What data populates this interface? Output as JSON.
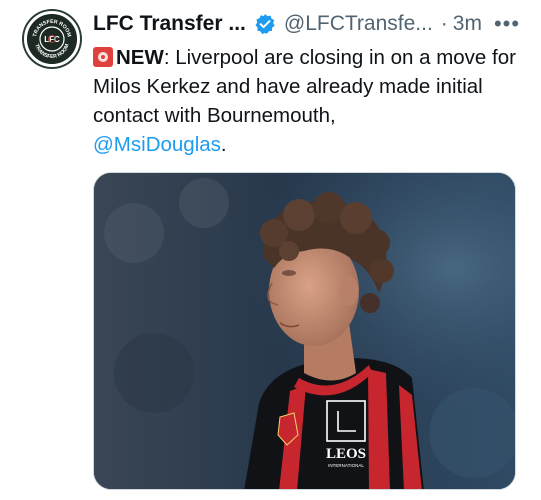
{
  "tweet": {
    "author": {
      "display_name": "LFC Transfer ...",
      "handle": "@LFCTransfe...",
      "verified": true,
      "avatar_icon": "transfer-room-logo-icon",
      "avatar_logo_text_top": "TRANSFER ROOM",
      "avatar_logo_text_bottom": "TRANSFER ROOM",
      "avatar_logo_center": "LFC"
    },
    "separator": "·",
    "time": "3m",
    "more_label": "•••",
    "text": {
      "siren_icon": "siren-emoji-icon",
      "lead_bold": "NEW",
      "lead_colon": ":",
      "body": " Liverpool are closing in on a move for Milos Kerkez and have already made initial contact with Bournemouth,",
      "mention": "@MsiDouglas",
      "trailing": "."
    },
    "media": {
      "alt_icon": "football-player-photo",
      "shirt_sponsor": "LEOS",
      "shirt_sponsor_sub": "INTERNATIONAL"
    }
  },
  "colors": {
    "text_primary": "#0f1419",
    "text_secondary": "#536471",
    "mention": "#1d9bf0",
    "verified": "#1d9bf0",
    "siren": "#e0413a"
  }
}
